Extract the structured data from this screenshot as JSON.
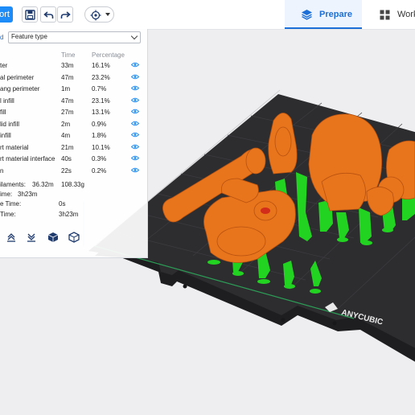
{
  "toolbar": {
    "import_label": "ort",
    "tabs": [
      {
        "label": "Prepare",
        "icon": "layers-icon"
      },
      {
        "label": "Work",
        "icon": "grid-icon"
      }
    ],
    "accent": "#1d8cf8"
  },
  "panel": {
    "link_text": "d",
    "view_type": "Feature type",
    "headers": {
      "time": "Time",
      "percentage": "Percentage"
    },
    "rows": [
      {
        "name": "ter",
        "time": "33m",
        "pct": "16.1%"
      },
      {
        "name": "al perimeter",
        "time": "47m",
        "pct": "23.2%"
      },
      {
        "name": "ang perimeter",
        "time": "1m",
        "pct": "0.7%"
      },
      {
        "name": "l infill",
        "time": "47m",
        "pct": "23.1%"
      },
      {
        "name": "fill",
        "time": "27m",
        "pct": "13.1%"
      },
      {
        "name": "lid infill",
        "time": "2m",
        "pct": "0.9%"
      },
      {
        "name": "infill",
        "time": "4m",
        "pct": "1.8%"
      },
      {
        "name": "rt material",
        "time": "21m",
        "pct": "10.1%"
      },
      {
        "name": "rt material interface",
        "time": "40s",
        "pct": "0.3%"
      },
      {
        "name": "n",
        "time": "22s",
        "pct": "0.2%"
      }
    ],
    "summary": {
      "filaments_label": "ilaments:",
      "filaments_length": "36.32m",
      "filaments_weight": "108.33g",
      "time_label": "ime:",
      "time_value": "3h23m",
      "e_time_label": "e Time:",
      "e_time_value": "0s",
      "total_label": "Time:",
      "total_value": "3h23m"
    }
  },
  "bed": {
    "brand": "ANYCUBIC",
    "model_color": "#e8741c",
    "support_color": "#2bd62b",
    "bed_color": "#2b2b2d"
  }
}
